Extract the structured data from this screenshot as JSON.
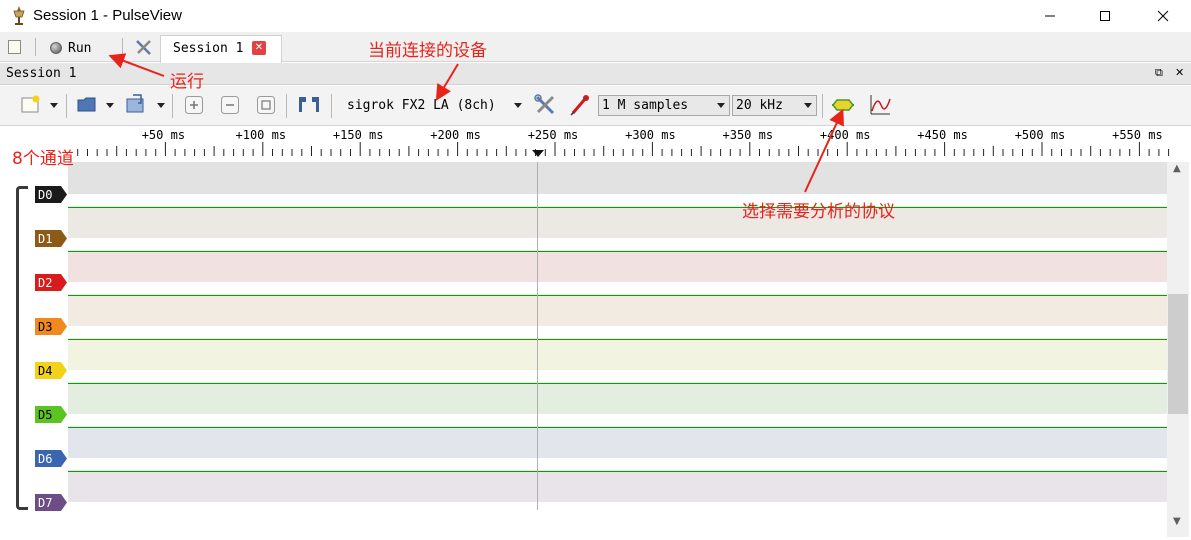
{
  "window": {
    "title": "Session 1 - PulseView",
    "icons": {
      "app": "pulseview-app-icon",
      "minimize": "minimize-icon",
      "maximize": "maximize-icon",
      "close": "close-icon"
    }
  },
  "tabbar": {
    "run_label": "Run",
    "tab_label": "Session 1"
  },
  "session": {
    "title": "Session 1"
  },
  "toolbar": {
    "device": "sigrok FX2 LA (8ch)",
    "samples": "1 M samples",
    "rate": "20 kHz"
  },
  "ruler": {
    "ticks": [
      "+50 ms",
      "+100 ms",
      "+150 ms",
      "+200 ms",
      "+250 ms",
      "+300 ms",
      "+350 ms",
      "+400 ms",
      "+450 ms",
      "+500 ms",
      "+550 ms"
    ]
  },
  "channels": [
    {
      "name": "D0",
      "color": "#1a1a1a",
      "text_color": "#ffffff",
      "band": "#e2e2e2"
    },
    {
      "name": "D1",
      "color": "#8b5a16",
      "text_color": "#ffffff",
      "band": "#ece8e4"
    },
    {
      "name": "D2",
      "color": "#d81b1b",
      "text_color": "#ffffff",
      "band": "#f1e1e1"
    },
    {
      "name": "D3",
      "color": "#f08a1e",
      "text_color": "#000000",
      "band": "#f2ebe2"
    },
    {
      "name": "D4",
      "color": "#f4d21a",
      "text_color": "#000000",
      "band": "#f3f3e2"
    },
    {
      "name": "D5",
      "color": "#5bc421",
      "text_color": "#000000",
      "band": "#e4eee0"
    },
    {
      "name": "D6",
      "color": "#3a65b0",
      "text_color": "#ffffff",
      "band": "#e2e6ec"
    },
    {
      "name": "D7",
      "color": "#6d4d86",
      "text_color": "#ffffff",
      "band": "#e8e4ea"
    }
  ],
  "annotations": {
    "device_note": "当前连接的设备",
    "run_note": "运行",
    "channels_note": "8个通道",
    "protocol_note": "选择需要分析的协议"
  },
  "colors": {
    "annotation": "#e8231a",
    "signal": "#0a9c0a"
  }
}
